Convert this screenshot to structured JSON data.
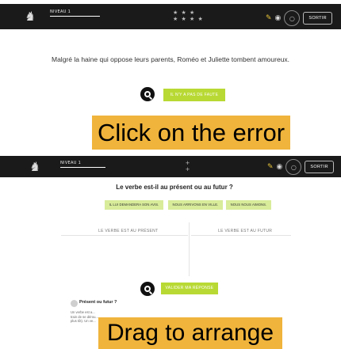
{
  "screen1": {
    "level_label": "NIVEAU 1",
    "stars": "★ ★ ★\n★ ★ ★ ★",
    "exit_label": "SORTIR",
    "sentence": "Malgré la haine qui oppose leurs parents, Roméo et Juliette tombent amoureux.",
    "no_error_label": "IL N'Y A PAS DE FAUTE",
    "caption": "Click on the error"
  },
  "screen2": {
    "level_label": "NIVEAU 1",
    "stars": "+\n+",
    "exit_label": "SORTIR",
    "question": "Le verbe est-il au présent ou au futur ?",
    "chips": [
      "IL LUI DEMANDERA SON AVIS.",
      "NOUS ARRIVONS EN VILLE.",
      "NOUS NOUS AIMONS."
    ],
    "column_present": "LE VERBE EST AU PRÉSENT",
    "column_future": "LE VERBE EST AU FUTUR",
    "validate_label": "VALIDER MA RÉPONSE",
    "help_title": "Présent ou futur ?",
    "help_text": "Un verbe est a... train de se dérou... plus tôt). Un ve...",
    "caption": "Drag to arrange"
  },
  "icons": {
    "logo": "horse-logo-icon",
    "pencil": "pencil-icon",
    "eye": "eye-icon",
    "settings": "circle-menu-icon",
    "search": "magnifier-icon",
    "help": "help-circle-icon"
  },
  "colors": {
    "bar": "#1a1a1a",
    "green_button": "#b8d934",
    "chip": "#d8ec9a",
    "caption": "#f0b43c"
  }
}
